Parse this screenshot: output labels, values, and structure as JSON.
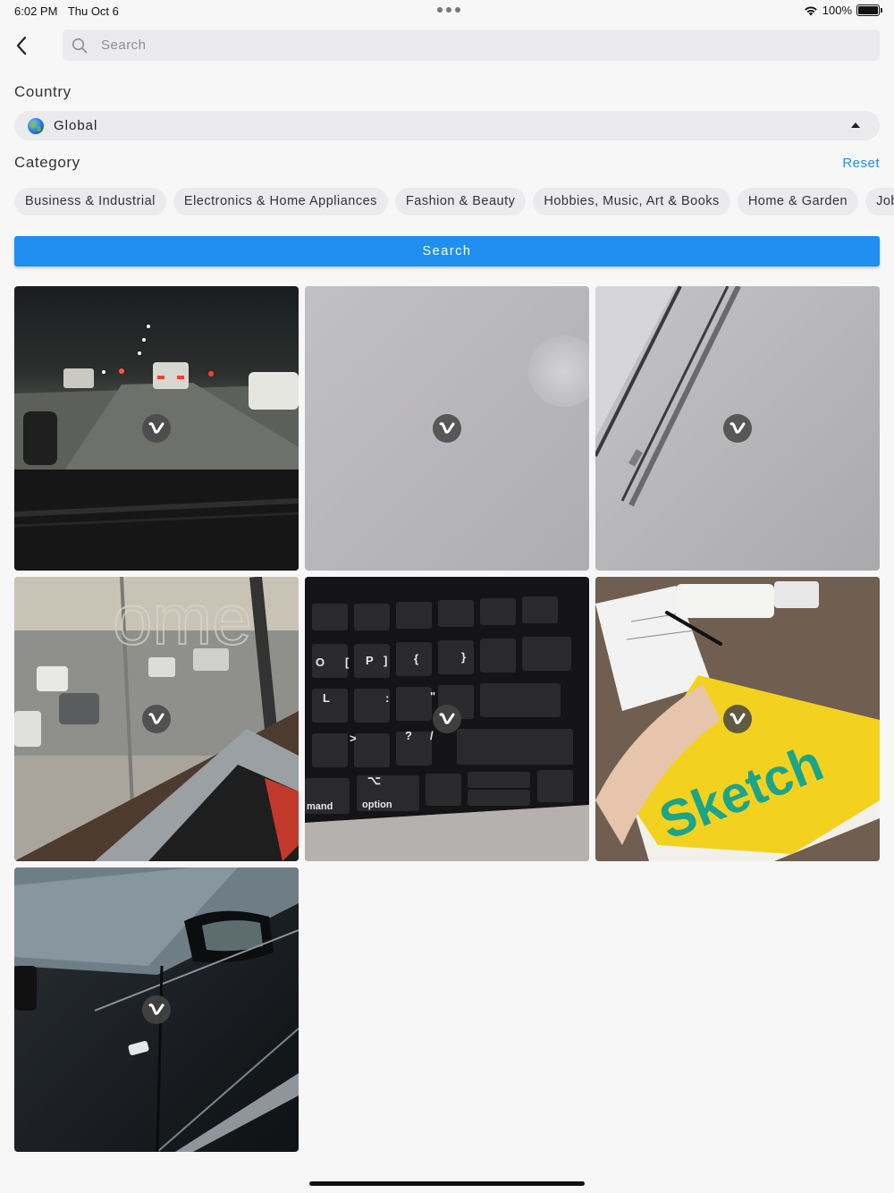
{
  "status_bar": {
    "time": "6:02 PM",
    "date": "Thu Oct 6",
    "battery": "100%"
  },
  "search": {
    "placeholder": "Search"
  },
  "country": {
    "label": "Country",
    "value": "Global"
  },
  "category": {
    "label": "Category",
    "reset_label": "Reset",
    "chips": [
      "Business & Industrial",
      "Electronics & Home Appliances",
      "Fashion & Beauty",
      "Hobbies, Music, Art & Books",
      "Home & Garden",
      "Jobs"
    ]
  },
  "search_button": {
    "label": "Search"
  },
  "colors": {
    "accent": "#1f8ff0",
    "link": "#1a8cf0",
    "chip_bg": "#ebebed",
    "background": "#f7f7f8"
  },
  "media_grid": {
    "badge_icon": "vimeo-v-icon",
    "items": [
      {
        "scene": "night-highway-traffic"
      },
      {
        "scene": "grey-ceiling"
      },
      {
        "scene": "wall-trim-corner"
      },
      {
        "scene": "window-view-parking"
      },
      {
        "scene": "keyboard-closeup",
        "key_labels": [
          "option",
          "mand"
        ]
      },
      {
        "scene": "sketch-notebook",
        "notebook_title": "Sketch"
      },
      {
        "scene": "black-car-door"
      }
    ]
  }
}
